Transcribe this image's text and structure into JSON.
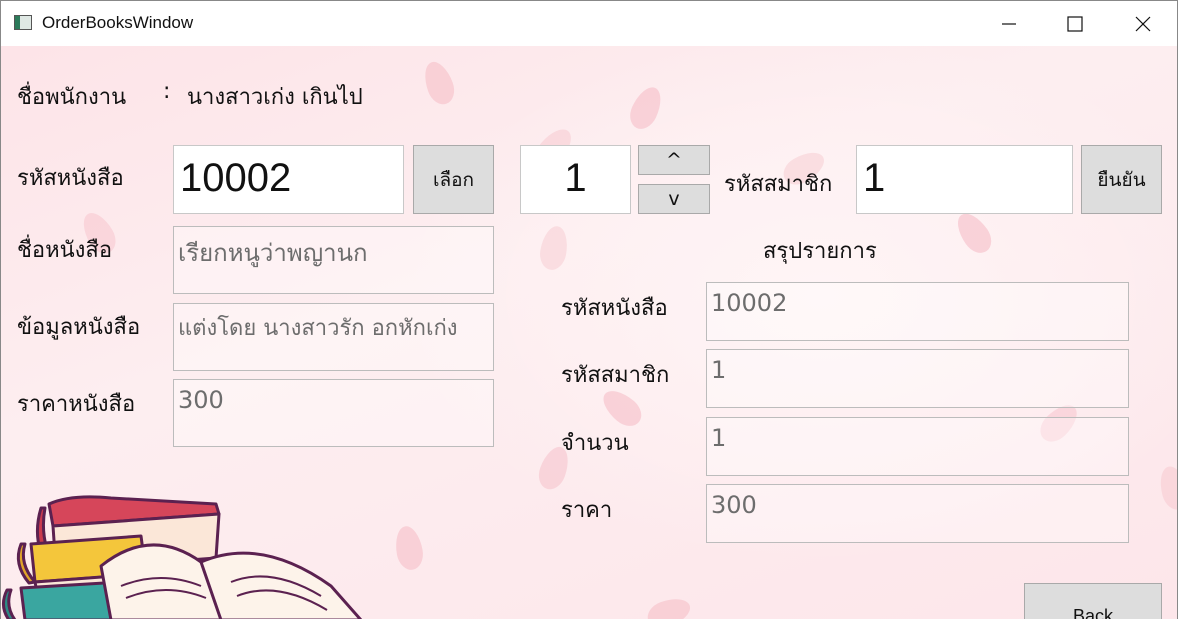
{
  "window": {
    "title": "OrderBooksWindow"
  },
  "employee": {
    "label": "ชื่อพนักงาน",
    "separator": ":",
    "name": "นางสาวเก่ง เกินไป"
  },
  "book_code": {
    "label": "รหัสหนังสือ",
    "value": "10002",
    "select_label": "เลือก"
  },
  "quantity": {
    "value": "1",
    "up_label": "^",
    "down_label": "v"
  },
  "member": {
    "label": "รหัสสมาชิก",
    "value": "1",
    "confirm_label": "ยืนยัน"
  },
  "book_name": {
    "label": "ชื่อหนังสือ",
    "value": "เรียกหนูว่าพญานก"
  },
  "book_info": {
    "label": "ข้อมูลหนังสือ",
    "value": "แต่งโดย นางสาวรัก อกหักเก่ง"
  },
  "book_price": {
    "label": "ราคาหนังสือ",
    "value": "300"
  },
  "summary": {
    "title": "สรุปรายการ",
    "rows": [
      {
        "label": "รหัสหนังสือ",
        "value": "10002"
      },
      {
        "label": "รหัสสมาชิก",
        "value": "1"
      },
      {
        "label": "จำนวน",
        "value": "1"
      },
      {
        "label": "ราคา",
        "value": "300"
      }
    ]
  },
  "back_label": "Back",
  "colors": {
    "background": "#fde8ec",
    "petal": "#f7c5cd",
    "button": "#dddddd"
  },
  "decoration": "books-illustration"
}
